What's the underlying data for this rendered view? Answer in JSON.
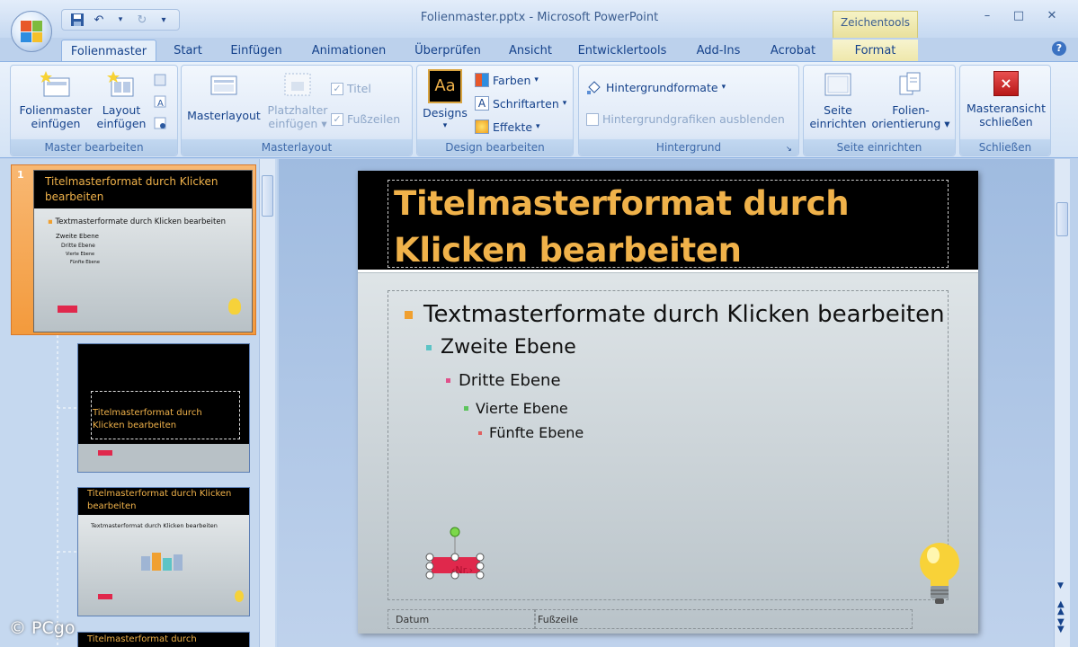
{
  "app": {
    "title": "Folienmaster.pptx - Microsoft PowerPoint",
    "context_tools": "Zeichentools",
    "window_controls": [
      "–",
      "□",
      "✕"
    ]
  },
  "tabs": [
    {
      "label": "Folienmaster",
      "active": true
    },
    {
      "label": "Start"
    },
    {
      "label": "Einfügen"
    },
    {
      "label": "Animationen"
    },
    {
      "label": "Überprüfen"
    },
    {
      "label": "Ansicht"
    },
    {
      "label": "Entwicklertools"
    },
    {
      "label": "Add-Ins"
    },
    {
      "label": "Acrobat"
    },
    {
      "label": "Format"
    }
  ],
  "ribbon": {
    "master_bearbeiten": {
      "label": "Master bearbeiten",
      "folienmaster_einfuegen": [
        "Folienmaster",
        "einfügen"
      ],
      "layout_einfuegen": [
        "Layout",
        "einfügen"
      ]
    },
    "masterlayout": {
      "label": "Masterlayout",
      "masterlayout_btn": "Masterlayout",
      "platzhalter": [
        "Platzhalter",
        "einfügen"
      ],
      "titel": "Titel",
      "fusszeilen": "Fußzeilen"
    },
    "design_bearbeiten": {
      "label": "Design bearbeiten",
      "designs": "Designs",
      "farben": "Farben",
      "schriftarten": "Schriftarten",
      "effekte": "Effekte"
    },
    "hintergrund": {
      "label": "Hintergrund",
      "hintergrundformate": "Hintergrundformate",
      "ausblenden": "Hintergrundgrafiken ausblenden"
    },
    "seite_einrichten": {
      "label": "Seite einrichten",
      "seite": [
        "Seite",
        "einrichten"
      ],
      "orientierung": [
        "Folien-",
        "orientierung"
      ]
    },
    "schliessen": {
      "label": "Schließen",
      "masteransicht": [
        "Masteransicht",
        "schließen"
      ]
    }
  },
  "thumbnails": {
    "number": "1",
    "t1_title": "Titelmasterformat durch Klicken bearbeiten",
    "t1_l1": "Textmasterformate durch Klicken bearbeiten",
    "t1_l2": "Zweite Ebene",
    "t1_l3": "Dritte Ebene",
    "t1_l4": "Vierte Ebene",
    "t1_l5": "Fünfte Ebene",
    "t2_title": "Titelmasterformat durch Klicken bearbeiten",
    "t3_title": "Titelmasterformat durch Klicken bearbeiten",
    "t3_l1": "Textmasterformat durch Klicken bearbeiten",
    "t4_title": "Titelmasterformat durch"
  },
  "slide": {
    "title": "Titelmasterformat durch Klicken bearbeiten",
    "levels": [
      "Textmasterformate durch Klicken bearbeiten",
      "Zweite Ebene",
      "Dritte Ebene",
      "Vierte Ebene",
      "Fünfte Ebene"
    ],
    "shape_label": "‹Nr.›",
    "footer_date": "Datum",
    "footer_text": "Fußzeile"
  },
  "copyright": "© PCgo",
  "colors": {
    "title_text": "#f0b24a",
    "bullet1": "#f0a030",
    "bullet2": "#5cc4c6",
    "bullet3": "#e0508a",
    "bullet4": "#5cc45c",
    "bullet5": "#e06060",
    "shape_fill": "#e0284c"
  }
}
